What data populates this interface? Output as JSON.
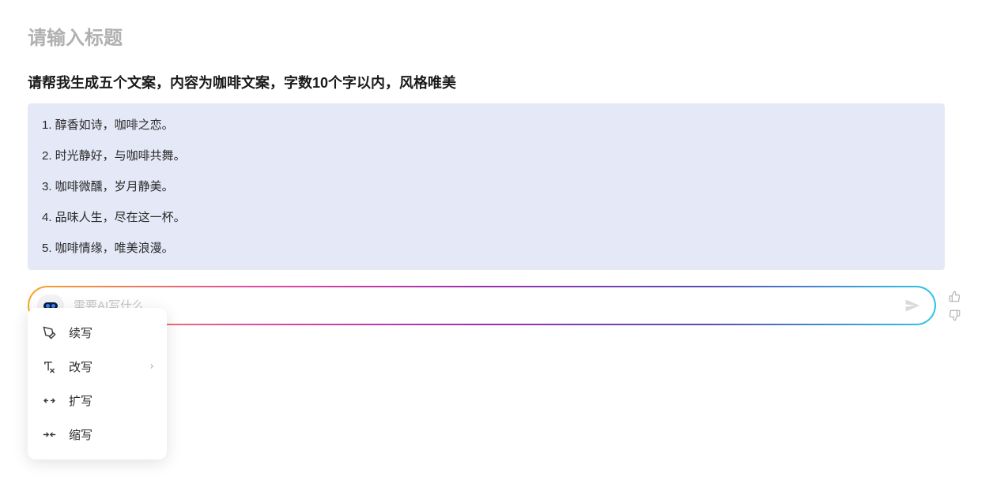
{
  "title_placeholder": "请输入标题",
  "prompt": "请帮我生成五个文案，内容为咖啡文案，字数10个字以内，风格唯美",
  "responses": [
    "1. 醇香如诗，咖啡之恋。",
    "2. 时光静好，与咖啡共舞。",
    "3. 咖啡微醺，岁月静美。",
    "4. 品味人生，尽在这一杯。",
    "5. 咖啡情缘，唯美浪漫。"
  ],
  "input": {
    "placeholder": "需要AI写什么",
    "value": ""
  },
  "menu": {
    "items": [
      {
        "label": "续写",
        "icon": "continue-write-icon",
        "has_submenu": false
      },
      {
        "label": "改写",
        "icon": "rewrite-icon",
        "has_submenu": true
      },
      {
        "label": "扩写",
        "icon": "expand-icon",
        "has_submenu": false
      },
      {
        "label": "缩写",
        "icon": "shrink-icon",
        "has_submenu": false
      }
    ]
  }
}
